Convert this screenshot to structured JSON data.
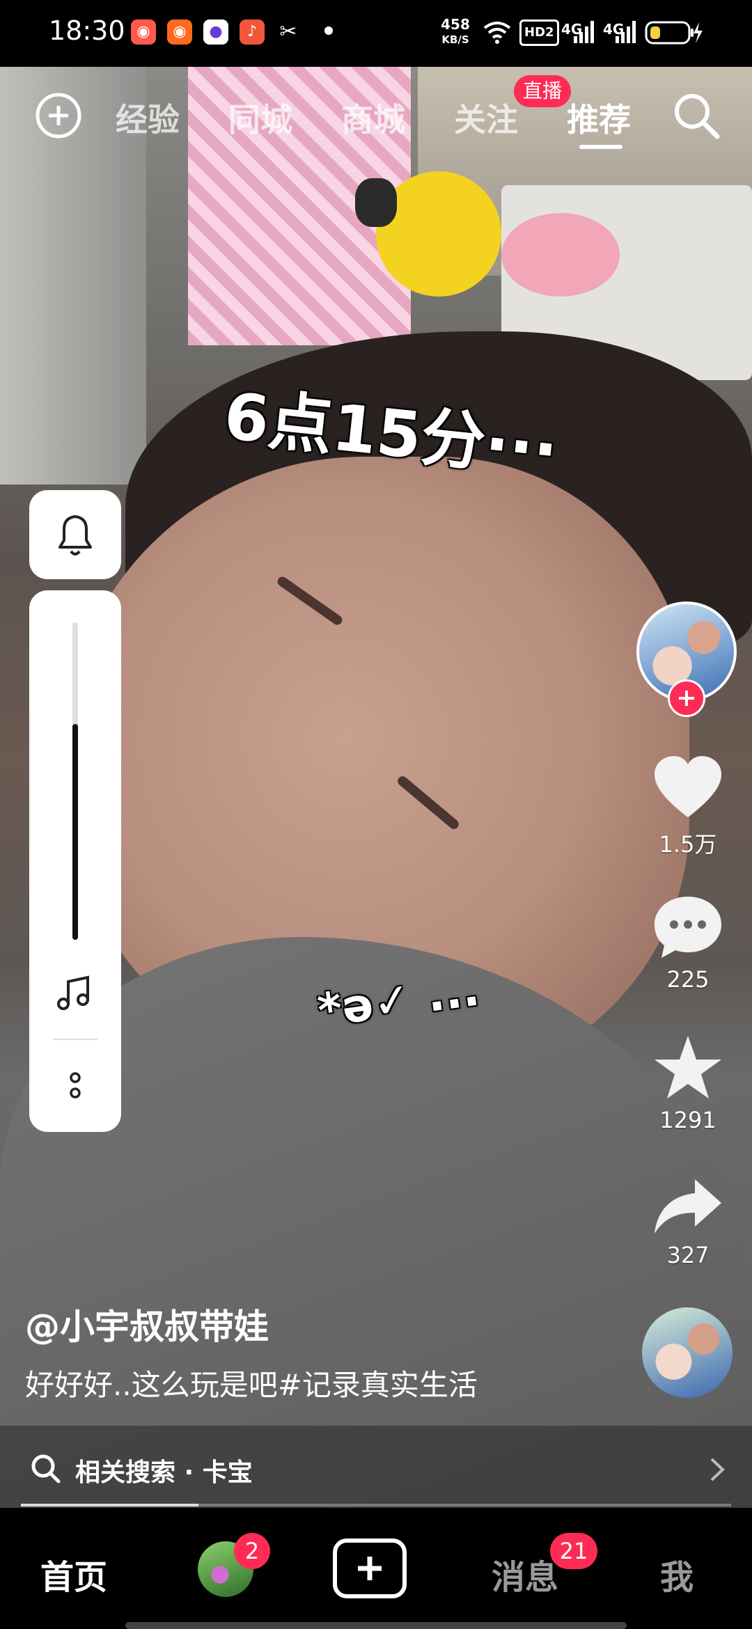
{
  "status_bar": {
    "time": "18:30",
    "app_icons": [
      "kuaishou-icon",
      "kuaishou-icon",
      "browser-icon",
      "music-icon",
      "capcut-icon"
    ],
    "net_speed_value": "458",
    "net_speed_unit": "KB/S",
    "signal_labels": [
      "HD2",
      "4G",
      "4G"
    ]
  },
  "top_tabs": {
    "items": [
      "经验",
      "同城",
      "商城",
      "关注",
      "推荐"
    ],
    "active_index": 4,
    "live_badge": "直播",
    "icons": [
      "plus-circle-icon",
      "search-icon"
    ]
  },
  "video": {
    "overlay_text_top": "6点15分···",
    "overlay_text_mid": "*ə✓ ..."
  },
  "side_panel": {
    "icons": [
      "bell-icon",
      "music-note-icon",
      "more-dots-icon"
    ],
    "volume_level": 0.68
  },
  "right_rail": {
    "likes": "1.5万",
    "comments": "225",
    "favorites": "1291",
    "shares": "327",
    "icons": [
      "heart-icon",
      "comment-icon",
      "star-icon",
      "share-icon",
      "follow-plus-icon"
    ]
  },
  "post": {
    "author": "@小宇叔叔带娃",
    "caption": "好好好..这么玩是吧#记录真实生活"
  },
  "related_search": {
    "label": "相关搜索 · 卡宝",
    "icons": [
      "search-icon",
      "chevron-right-icon"
    ]
  },
  "playback": {
    "progress": 0.25
  },
  "bottom_nav": {
    "home": "首页",
    "friends_badge": "2",
    "messages": "消息",
    "messages_badge": "21",
    "me": "我",
    "icons": [
      "avatar",
      "create-plus-icon"
    ]
  },
  "colors": {
    "accent": "#fe2c55",
    "background": "#000000"
  }
}
